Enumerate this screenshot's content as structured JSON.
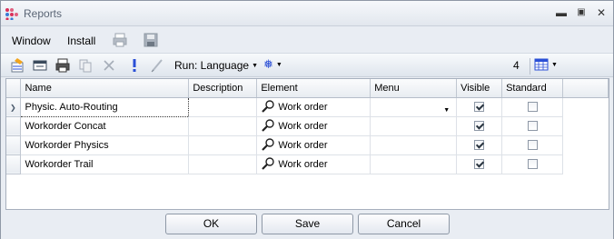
{
  "window": {
    "title": "Reports"
  },
  "menubar": {
    "items": [
      {
        "label": "Window"
      },
      {
        "label": "Install"
      }
    ]
  },
  "toolbar": {
    "run_label": "Run: Language",
    "count": "4"
  },
  "grid": {
    "columns": [
      "Name",
      "Description",
      "Element",
      "Menu",
      "Visible",
      "Standard"
    ],
    "rows": [
      {
        "name": "Physic. Auto-Routing",
        "description": "",
        "element": "Work order",
        "menu": "",
        "visible": true,
        "standard": false
      },
      {
        "name": "Workorder Concat",
        "description": "",
        "element": "Work order",
        "menu": "",
        "visible": true,
        "standard": false
      },
      {
        "name": "Workorder Physics",
        "description": "",
        "element": "Work order",
        "menu": "",
        "visible": true,
        "standard": false
      },
      {
        "name": "Workorder Trail",
        "description": "",
        "element": "Work order",
        "menu": "",
        "visible": true,
        "standard": false
      }
    ]
  },
  "footer": {
    "ok": "OK",
    "save": "Save",
    "cancel": "Cancel"
  },
  "colors": {
    "accent": "#2a4fd6",
    "border": "#8f98a6",
    "app_icon": "#d9305b"
  }
}
